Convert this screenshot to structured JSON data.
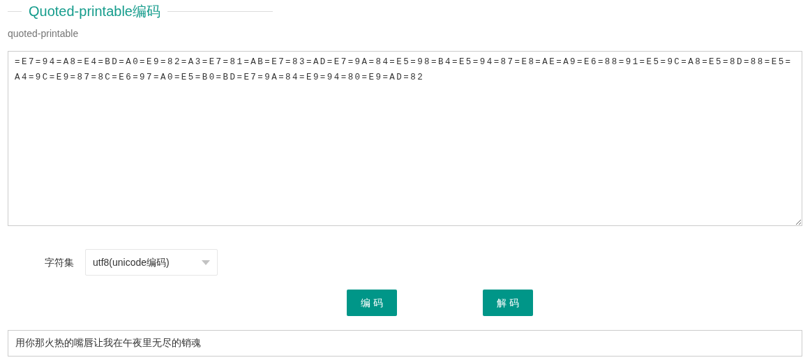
{
  "title": "Quoted-printable编码",
  "subtitle": "quoted-printable",
  "input": {
    "value": "=E7=94=A8=E4=BD=A0=E9=82=A3=E7=81=AB=E7=83=AD=E7=9A=84=E5=98=B4=E5=94=87=E8=AE=A9=E6=88=91=E5=9C=A8=E5=8D=88=E5=A4=9C=E9=87=8C=E6=97=A0=E5=B0=BD=E7=9A=84=E9=94=80=E9=AD=82"
  },
  "charset": {
    "label": "字符集",
    "value": "utf8(unicode编码)"
  },
  "buttons": [
    "编 码",
    "解 码"
  ],
  "output": {
    "value": "用你那火热的嘴唇让我在午夜里无尽的销魂"
  }
}
